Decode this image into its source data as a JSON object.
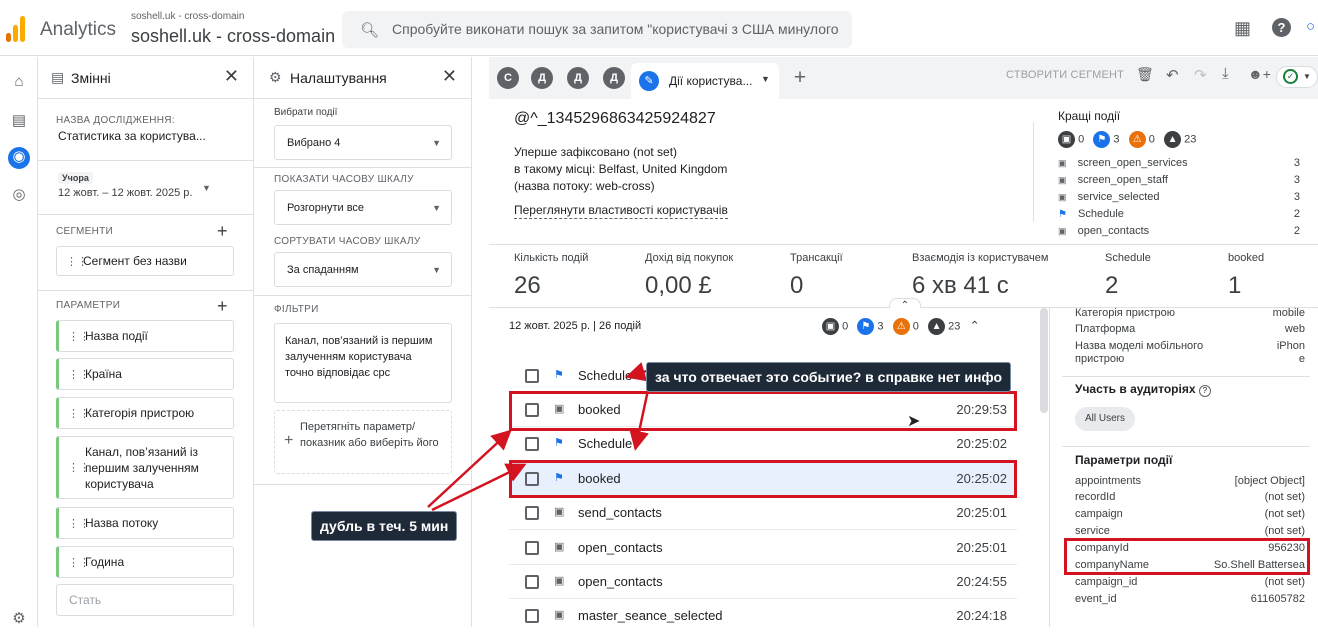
{
  "header": {
    "app_title": "Analytics",
    "account_small": "soshell.uk - cross-domain",
    "account_big": "soshell.uk - cross-domain",
    "search_placeholder": "Спробуйте виконати пошук за запитом \"користувачі з США минулого т..."
  },
  "variables": {
    "title": "Змінні",
    "study_label": "НАЗВА ДОСЛІДЖЕННЯ:",
    "study_name": "Статистика за користува...",
    "date_badge": "Учора",
    "date_range": "12 жовт. – 12 жовт. 2025 р.",
    "segments_label": "СЕГМЕНТИ",
    "segment": "Сегмент без назви",
    "params_label": "ПАРАМЕТРИ",
    "params": [
      "Назва події",
      "Країна",
      "Категорія пристрою",
      "Канал, пов’язаний із першим залученням користувача",
      "Назва потоку",
      "Година"
    ],
    "add_placeholder": "Стать"
  },
  "settings": {
    "title": "Налаштування",
    "select_events_label": "Вибрати події",
    "select_events_value": "Вибрано 4",
    "timeline_label": "ПОКАЗАТИ ЧАСОВУ ШКАЛУ",
    "timeline_value": "Розгорнути все",
    "sort_label": "СОРТУВАТИ ЧАСОВУ ШКАЛУ",
    "sort_value": "За спаданням",
    "filters_label": "ФІЛЬТРИ",
    "filter_text": "Канал, пов’язаний із першим залученням користувача точно відповідає cpc",
    "drop_text": "Перетягніть параметр/ показник або виберіть його"
  },
  "tabs": {
    "letters": [
      "С",
      "Д",
      "Д",
      "Д"
    ],
    "active": "Дії користува...",
    "create_segment": "СТВОРИТИ СЕГМЕНТ"
  },
  "user": {
    "id": "@^_1345296863425924827",
    "first_seen": "Уперше зафіксовано (not set)",
    "place": "в такому місці: Belfast, United Kingdom",
    "stream": "(назва потоку: web-cross)",
    "props_link": "Переглянути властивості користувачів"
  },
  "top_events": {
    "title": "Кращі події",
    "counts": [
      "0",
      "3",
      "0",
      "23"
    ],
    "items": [
      {
        "name": "screen_open_services",
        "count": "3"
      },
      {
        "name": "screen_open_staff",
        "count": "3"
      },
      {
        "name": "service_selected",
        "count": "3"
      },
      {
        "name": "Schedule",
        "count": "2"
      },
      {
        "name": "open_contacts",
        "count": "2"
      }
    ]
  },
  "metrics": [
    {
      "label": "Кількість подій",
      "value": "26"
    },
    {
      "label": "Дохід від покупок",
      "value": "0,00 £"
    },
    {
      "label": "Трансакції",
      "value": "0"
    },
    {
      "label": "Взаємодія із користувачем",
      "value": "6 хв 41 с"
    },
    {
      "label": "Schedule",
      "value": "2"
    },
    {
      "label": "booked",
      "value": "1"
    }
  ],
  "timeline": {
    "header": "12 жовт. 2025 р. | 26 подій",
    "counts": [
      "0",
      "3",
      "0",
      "23"
    ],
    "rows": [
      {
        "name": "Schedule",
        "time": ""
      },
      {
        "name": "booked",
        "time": "20:29:53"
      },
      {
        "name": "Schedule",
        "time": "20:25:02"
      },
      {
        "name": "booked",
        "time": "20:25:02"
      },
      {
        "name": "send_contacts",
        "time": "20:25:01"
      },
      {
        "name": "open_contacts",
        "time": "20:25:01"
      },
      {
        "name": "open_contacts",
        "time": "20:24:55"
      },
      {
        "name": "master_seance_selected",
        "time": "20:24:18"
      }
    ]
  },
  "details": {
    "device": [
      {
        "k": "Категорія пристрою",
        "v": "mobile"
      },
      {
        "k": "Платформа",
        "v": "web"
      },
      {
        "k": "Назва моделі мобільного пристрою",
        "v": "iPhone"
      }
    ],
    "audiences_title": "Участь в аудиторіях",
    "audience_chip": "All Users",
    "params_title": "Параметри події",
    "params": [
      {
        "k": "appointments",
        "v": "[object Object]"
      },
      {
        "k": "recordId",
        "v": "(not set)"
      },
      {
        "k": "campaign",
        "v": "(not set)"
      },
      {
        "k": "service",
        "v": "(not set)"
      },
      {
        "k": "companyId",
        "v": "956230"
      },
      {
        "k": "companyName",
        "v": "So.Shell Battersea"
      },
      {
        "k": "campaign_id",
        "v": "(not set)"
      },
      {
        "k": "event_id",
        "v": "611605782"
      }
    ]
  },
  "annotations": {
    "top": "за что отвечает это событие? в справке нет инфо",
    "bottom": "дубль в теч. 5 мин"
  }
}
